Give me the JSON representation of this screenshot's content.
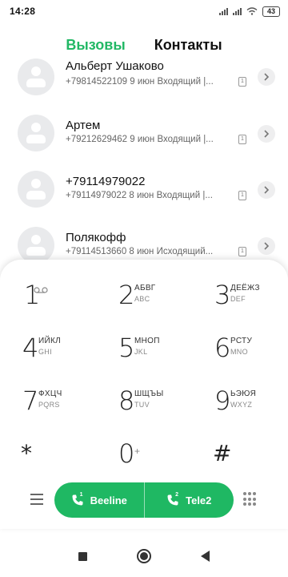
{
  "status_bar": {
    "time": "14:28",
    "battery": "43",
    "icons": [
      "signal-icon",
      "signal-icon",
      "wifi-icon",
      "battery-icon"
    ]
  },
  "tabs": [
    {
      "label": "Вызовы",
      "active": true
    },
    {
      "label": "Контакты",
      "active": false
    }
  ],
  "calls": [
    {
      "name": "Альберт Ушаково",
      "detail": "+79814522109  9 июн Входящий |...",
      "sim": "1"
    },
    {
      "name": "Артем",
      "detail": "+79212629462  9 июн Входящий |...",
      "sim": "1"
    },
    {
      "name": "+79114979022",
      "detail": "+79114979022  8 июн Входящий |...",
      "sim": "1"
    },
    {
      "name": "Полякофф",
      "detail": "+79114513660  8 июн Исходящий...",
      "sim": "1"
    }
  ],
  "dialpad": {
    "keys": [
      {
        "digit": "1",
        "letters": "",
        "latin": ""
      },
      {
        "digit": "2",
        "letters": "АБВГ",
        "latin": "ABC"
      },
      {
        "digit": "3",
        "letters": "ДЕЁЖЗ",
        "latin": "DEF"
      },
      {
        "digit": "4",
        "letters": "ИЙКЛ",
        "latin": "GHI"
      },
      {
        "digit": "5",
        "letters": "МНОП",
        "latin": "JKL"
      },
      {
        "digit": "6",
        "letters": "РСТУ",
        "latin": "MNO"
      },
      {
        "digit": "7",
        "letters": "ФХЦЧ",
        "latin": "PQRS"
      },
      {
        "digit": "8",
        "letters": "ШЩЪЫ",
        "latin": "TUV"
      },
      {
        "digit": "9",
        "letters": "ЬЭЮЯ",
        "latin": "WXYZ"
      },
      {
        "digit": "*",
        "letters": "",
        "latin": ""
      },
      {
        "digit": "0",
        "letters": "+",
        "latin": ""
      },
      {
        "digit": "#",
        "letters": "",
        "latin": ""
      }
    ],
    "sim_buttons": [
      {
        "label": "Beeline",
        "sim": "1"
      },
      {
        "label": "Tele2",
        "sim": "2"
      }
    ],
    "accent_color": "#1fb863"
  },
  "colors": {
    "active_tab": "#22b865",
    "call_button": "#1fb863"
  }
}
